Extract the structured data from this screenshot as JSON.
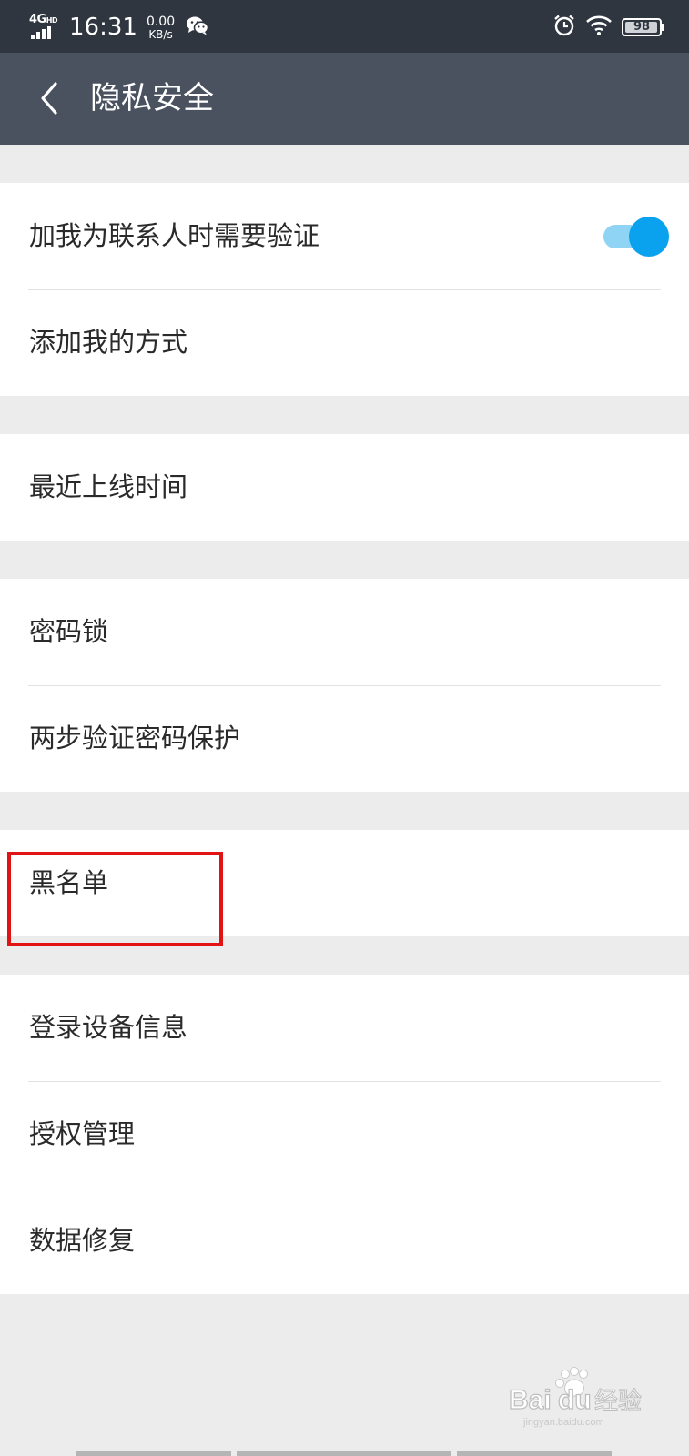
{
  "status_bar": {
    "network": "4G",
    "network_suffix": "HD",
    "time": "16:31",
    "speed_value": "0.00",
    "speed_unit": "KB/s",
    "battery": "98",
    "icons": [
      "signal-icon",
      "wechat-icon",
      "alarm-icon",
      "wifi-icon",
      "battery-icon"
    ]
  },
  "header": {
    "title": "隐私安全",
    "back_icon": "chevron-left-icon"
  },
  "groups": [
    {
      "items": [
        {
          "label": "加我为联系人时需要验证",
          "toggle": true
        },
        {
          "label": "添加我的方式"
        }
      ]
    },
    {
      "items": [
        {
          "label": "最近上线时间"
        }
      ]
    },
    {
      "items": [
        {
          "label": "密码锁"
        },
        {
          "label": "两步验证密码保护"
        }
      ]
    },
    {
      "items": [
        {
          "label": "黑名单",
          "highlighted": true
        }
      ]
    },
    {
      "items": [
        {
          "label": "登录设备信息"
        },
        {
          "label": "授权管理"
        },
        {
          "label": "数据修复"
        }
      ]
    }
  ],
  "colors": {
    "status_bar": "#2f3640",
    "title_bar": "#4a5260",
    "background": "#ececec",
    "toggle_on": "#0aa1ef",
    "highlight": "#e01414"
  },
  "watermark": {
    "logo": "Baidu",
    "text": "经验",
    "url": "jingyan.baidu.com"
  }
}
